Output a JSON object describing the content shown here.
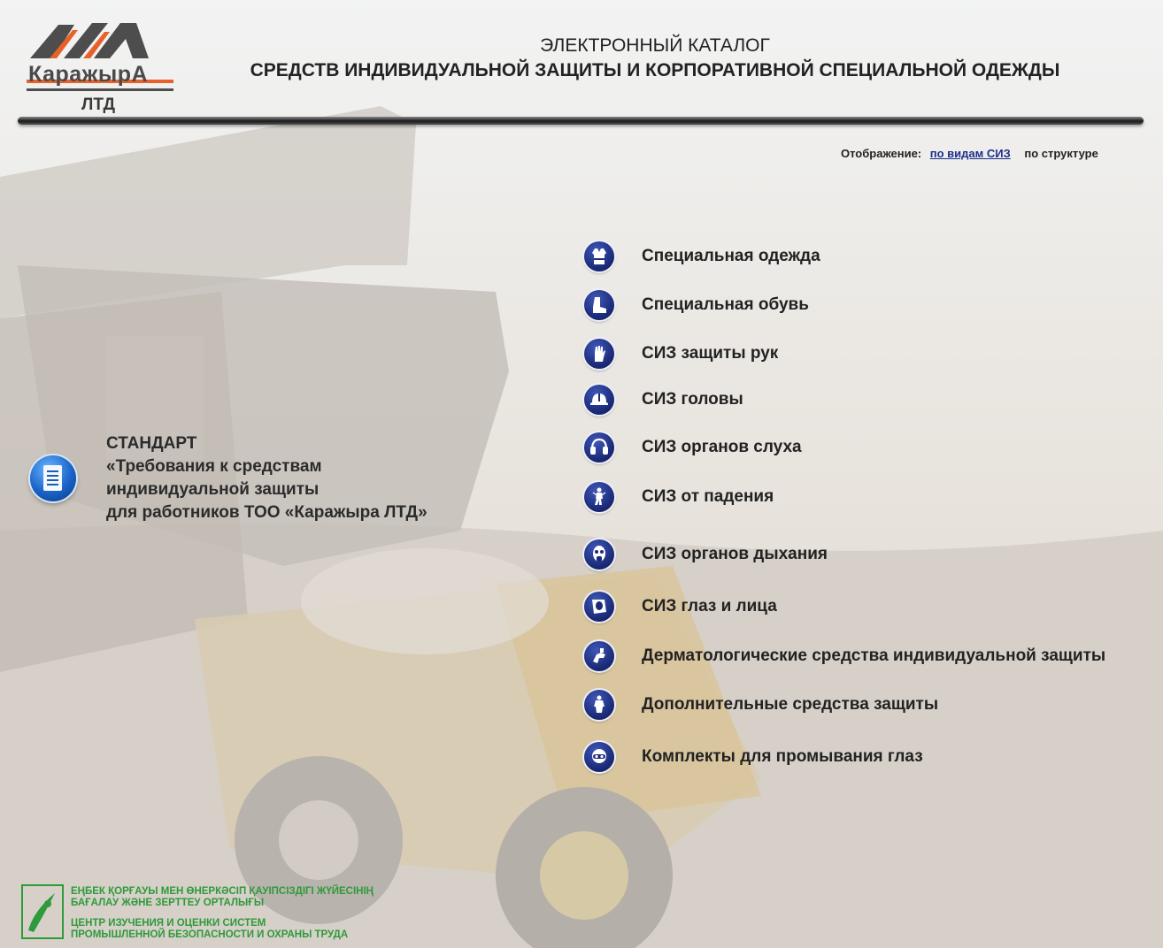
{
  "brand": {
    "name": "КаражырА",
    "sub": "ЛТД"
  },
  "header": {
    "title_line1": "ЭЛЕКТРОННЫЙ КАТАЛОГ",
    "title_line2": "СРЕДСТВ ИНДИВИДУАЛЬНОЙ ЗАЩИТЫ И КОРПОРАТИВНОЙ СПЕЦИАЛЬНОЙ ОДЕЖДЫ"
  },
  "view_switch": {
    "label": "Отображение:",
    "selected": "по видам СИЗ",
    "alternative": "по структуре"
  },
  "standard": {
    "line1": "СТАНДАРТ",
    "line2": "«Требования к средствам",
    "line3": "индивидуальной защиты",
    "line4": "для работников ТОО «Каражыра ЛТД»"
  },
  "categories": [
    {
      "label": "Специальная одежда",
      "icon": "vest-icon"
    },
    {
      "label": "Специальная обувь",
      "icon": "boot-icon"
    },
    {
      "label": "СИЗ защиты рук",
      "icon": "glove-icon"
    },
    {
      "label": "СИЗ головы",
      "icon": "helmet-icon"
    },
    {
      "label": "СИЗ органов слуха",
      "icon": "ear-protection-icon"
    },
    {
      "label": "СИЗ от падения",
      "icon": "harness-icon"
    },
    {
      "label": "СИЗ органов дыхания",
      "icon": "respirator-icon"
    },
    {
      "label": "СИЗ глаз и лица",
      "icon": "face-shield-icon"
    },
    {
      "label": "Дерматологические средства индивидуальной защиты",
      "icon": "hand-cream-icon"
    },
    {
      "label": "Дополнительные средства защиты",
      "icon": "coverall-icon"
    },
    {
      "label": "Комплекты для промывания глаз",
      "icon": "goggles-icon"
    }
  ],
  "footer": {
    "kz_line1": "Еңбек қорғауы мен өнеркәсіп қауіпсіздігі жүйесінің",
    "kz_line2": "бағалау және зерттеу орталығы",
    "ru_line1": "Центр изучения и оценки систем",
    "ru_line2": "промышленной безопасности и охраны труда"
  },
  "colors": {
    "accent": "#1d2f8c",
    "icon_bg": "#1b2a78",
    "logo_orange": "#e8612a",
    "footer_green": "#2e9a3a"
  }
}
